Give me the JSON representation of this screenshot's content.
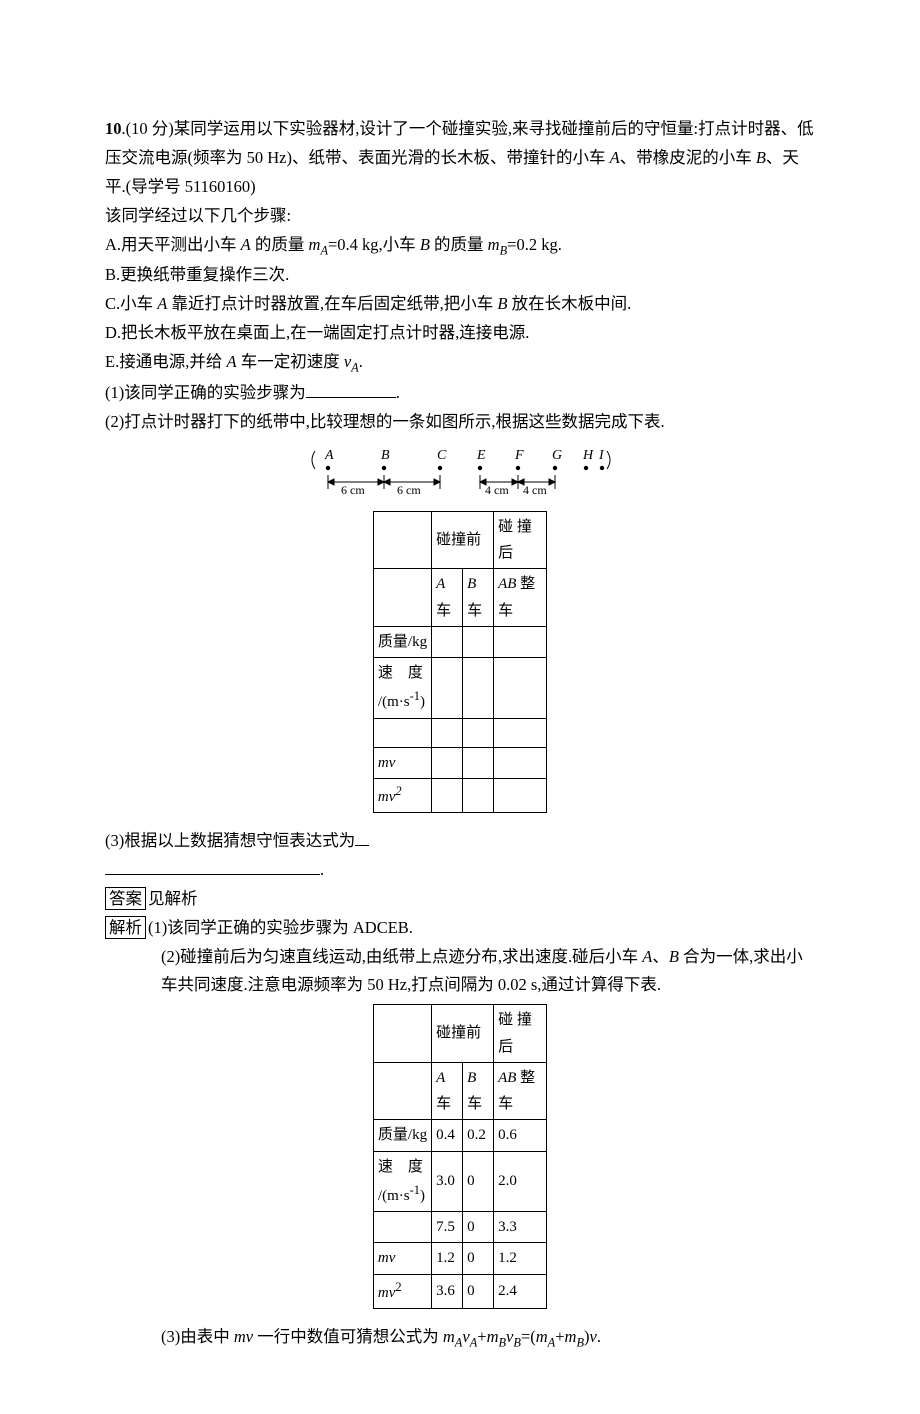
{
  "q": {
    "num": "10",
    "pts": ".(10 分)",
    "intro1": "某同学运用以下实验器材,设计了一个碰撞实验,来寻找碰撞前后的守恒量:打点计时器、低压交流电源(频率为 50 Hz)、纸带、表面光滑的长木板、带撞针的小车 ",
    "carA": "A",
    "intro2": "、带橡皮泥的小车 ",
    "carB": "B",
    "intro3": "、天平.(",
    "dxh_label": "导学号",
    "dxh_num": " 51160160)",
    "steps_hdr": "该同学经过以下几个步骤:",
    "stepA_pre": "A.用天平测出小车 ",
    "stepA_mid1": " 的质量 ",
    "stepA_mA": "mA",
    "stepA_mid2": "=0.4 kg,小车 ",
    "stepA_mid3": " 的质量 ",
    "stepA_mB": "mB",
    "stepA_end": "=0.2 kg.",
    "stepB": "B.更换纸带重复操作三次.",
    "stepC_pre": "C.小车 ",
    "stepC_mid": " 靠近打点计时器放置,在车后固定纸带,把小车 ",
    "stepC_end": " 放在长木板中间.",
    "stepD": "D.把长木板平放在桌面上,在一端固定打点计时器,连接电源.",
    "stepE_pre": "E.接通电源,并给 ",
    "stepE_mid": " 车一定初速度 ",
    "stepE_vA": "vA",
    "stepE_end": ".",
    "sub1": "(1)该同学正确的实验步骤为",
    "sub1_end": ".",
    "sub2": "(2)打点计时器打下的纸带中,比较理想的一条如图所示,根据这些数据完成下表.",
    "tape": {
      "labels": [
        "A",
        "B",
        "C",
        "E",
        "F",
        "G",
        "H",
        "I"
      ],
      "seg1": "6 cm",
      "seg2": "6 cm",
      "seg3": "4 cm",
      "seg4": "4 cm"
    },
    "tbl": {
      "before": "碰撞前",
      "after": "碰 撞后",
      "Acar": "A车",
      "Bcar": "B车",
      "ABcar": "AB 整车",
      "row_mass": "质量/kg",
      "row_v": "速 度/(m·s-1)",
      "row_mv": "mv",
      "row_mv2": "mv²"
    },
    "sub3": "(3)根据以上数据猜想守恒表达式为",
    "sub3_end": "."
  },
  "ans": {
    "daan_box": "答案",
    "daan_text": "见解析",
    "jiexi_box": "解析",
    "part1": "(1)该同学正确的实验步骤为 ADCEB.",
    "part2a": "(2)碰撞前后为匀速直线运动,由纸带上点迹分布,求出速度.碰后小车 ",
    "part2b": "、",
    "part2c": " 合为一体,求出小车共同速度.注意电源频率为 50 Hz,打点间隔为 0.02 s,通过计算得下表.",
    "tbl2": {
      "mass": {
        "A": "0.4",
        "B": "0.2",
        "AB": "0.6"
      },
      "v": {
        "A": "3.0",
        "B": "0",
        "AB": "2.0"
      },
      "blank": {
        "A": "7.5",
        "B": "0",
        "AB": "3.3"
      },
      "mv": {
        "A": "1.2",
        "B": "0",
        "AB": "1.2"
      },
      "mv2": {
        "A": "3.6",
        "B": "0",
        "AB": "2.4"
      }
    },
    "part3_pre": "(3)由表中 ",
    "part3_mv": "mv",
    "part3_mid": " 一行中数值可猜想公式为 ",
    "part3_eq": "mAvA+mBvB=(mA+mB)v."
  }
}
